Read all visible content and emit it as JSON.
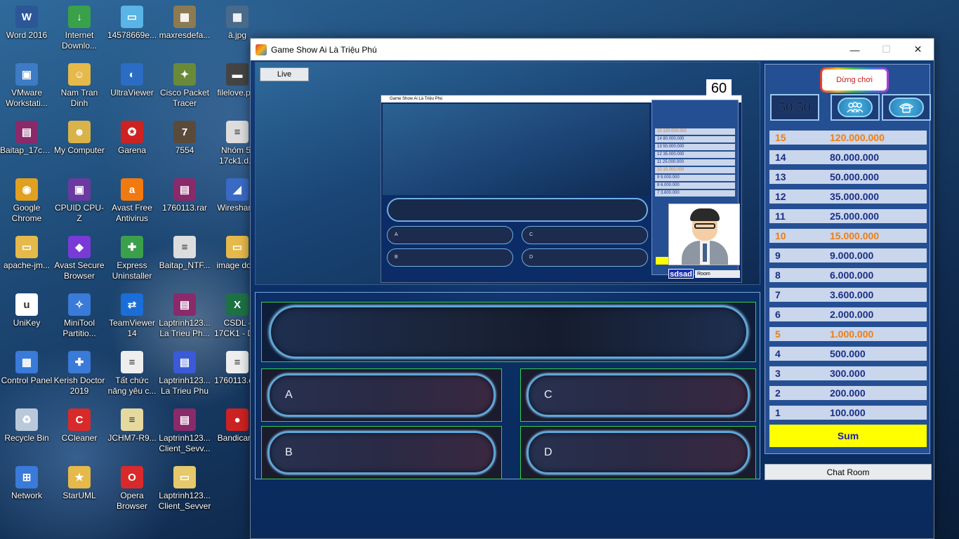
{
  "desktop": {
    "icons": [
      {
        "label": "Word 2016",
        "icon": "word-icon",
        "color": "#2b5797",
        "glyph": "W"
      },
      {
        "label": "Internet Downlo...",
        "icon": "idm-icon",
        "color": "#3aa04a",
        "glyph": "↓"
      },
      {
        "label": "14578669e...",
        "icon": "image-icon",
        "color": "#5ab4e6",
        "glyph": "▭"
      },
      {
        "label": "maxresdefa...",
        "icon": "image-icon",
        "color": "#8c7a52",
        "glyph": "▦"
      },
      {
        "label": "â.jpg",
        "icon": "image-icon",
        "color": "#4a6a8a",
        "glyph": "▦"
      },
      {
        "label": "VMware Workstati...",
        "icon": "vmware-icon",
        "color": "#3d7bc4",
        "glyph": "▣"
      },
      {
        "label": "Nam Tran Dinh",
        "icon": "user-folder-icon",
        "color": "#e5b94a",
        "glyph": "☺"
      },
      {
        "label": "UltraViewer",
        "icon": "ultraviewer-icon",
        "color": "#2b6cc4",
        "glyph": "◐"
      },
      {
        "label": "Cisco Packet Tracer",
        "icon": "cisco-icon",
        "color": "#6a8a3a",
        "glyph": "✦"
      },
      {
        "label": "filelove.p...",
        "icon": "file-icon",
        "color": "#444",
        "glyph": "▬"
      },
      {
        "label": "Baitap_17ck...",
        "icon": "winrar-icon",
        "color": "#8a2a6a",
        "glyph": "▤"
      },
      {
        "label": "My Computer",
        "icon": "computer-icon",
        "color": "#d9b34a",
        "glyph": "☻"
      },
      {
        "label": "Garena",
        "icon": "garena-icon",
        "color": "#c22",
        "glyph": "✪"
      },
      {
        "label": "7554",
        "icon": "game-icon",
        "color": "#5a4a3a",
        "glyph": "7"
      },
      {
        "label": "Nhóm 5-17ck1.d...",
        "icon": "document-icon",
        "color": "#ddd",
        "glyph": "≡"
      },
      {
        "label": "Google Chrome",
        "icon": "chrome-icon",
        "color": "#e0a020",
        "glyph": "◉"
      },
      {
        "label": "CPUID CPU-Z",
        "icon": "cpuz-icon",
        "color": "#6a3aa0",
        "glyph": "▣"
      },
      {
        "label": "Avast Free Antivirus",
        "icon": "avast-icon",
        "color": "#f07a10",
        "glyph": "a"
      },
      {
        "label": "1760113.rar",
        "icon": "winrar-icon",
        "color": "#8a2a6a",
        "glyph": "▤"
      },
      {
        "label": "Wireshar...",
        "icon": "wireshark-icon",
        "color": "#3a6ac4",
        "glyph": "◢"
      },
      {
        "label": "apache-jm...",
        "icon": "folder-icon",
        "color": "#e5b94a",
        "glyph": "▭"
      },
      {
        "label": "Avast Secure Browser",
        "icon": "avast-browser-icon",
        "color": "#7a3ad8",
        "glyph": "◆"
      },
      {
        "label": "Express Uninstaller",
        "icon": "uninstaller-icon",
        "color": "#3aa04a",
        "glyph": "✚"
      },
      {
        "label": "Baitap_NTF...",
        "icon": "document-icon",
        "color": "#ddd",
        "glyph": "≡"
      },
      {
        "label": "image do...",
        "icon": "folder-icon",
        "color": "#e5b94a",
        "glyph": "▭"
      },
      {
        "label": "UniKey",
        "icon": "unikey-icon",
        "color": "#ffffff",
        "glyph": "u"
      },
      {
        "label": "MiniTool Partitio...",
        "icon": "minitool-icon",
        "color": "#3a7ad8",
        "glyph": "✧"
      },
      {
        "label": "TeamViewer 14",
        "icon": "teamviewer-icon",
        "color": "#1a6ed8",
        "glyph": "⇄"
      },
      {
        "label": "Laptrinh123... La Trieu Ph...",
        "icon": "winrar-icon",
        "color": "#8a2a6a",
        "glyph": "▤"
      },
      {
        "label": "CSDL - 17CK1 - D...",
        "icon": "excel-icon",
        "color": "#1e7145",
        "glyph": "X"
      },
      {
        "label": "Control Panel",
        "icon": "control-panel-icon",
        "color": "#3a7ad8",
        "glyph": "▦"
      },
      {
        "label": "Kerish Doctor 2019",
        "icon": "kerish-icon",
        "color": "#3a7ad8",
        "glyph": "✚"
      },
      {
        "label": "Tất chức năng yêu c...",
        "icon": "document-icon",
        "color": "#eee",
        "glyph": "≡"
      },
      {
        "label": "Laptrinh123... La Trieu Phu",
        "icon": "winrar-icon",
        "color": "#3a5ad8",
        "glyph": "▤"
      },
      {
        "label": "1760113.d...",
        "icon": "document-icon",
        "color": "#eee",
        "glyph": "≡"
      },
      {
        "label": "Recycle Bin",
        "icon": "recycle-bin-icon",
        "color": "#b9c9d9",
        "glyph": "♻"
      },
      {
        "label": "CCleaner",
        "icon": "ccleaner-icon",
        "color": "#d82a2a",
        "glyph": "C"
      },
      {
        "label": "JCHM7-R9...",
        "icon": "document-icon",
        "color": "#e5d9a0",
        "glyph": "≡"
      },
      {
        "label": "Laptrinh123... Client_Sevv...",
        "icon": "winrar-icon",
        "color": "#8a2a6a",
        "glyph": "▤"
      },
      {
        "label": "Bandicar...",
        "icon": "bandicam-icon",
        "color": "#c22",
        "glyph": "●"
      },
      {
        "label": "Network",
        "icon": "network-icon",
        "color": "#3a7ad8",
        "glyph": "⊞"
      },
      {
        "label": "StarUML",
        "icon": "staruml-icon",
        "color": "#e5b94a",
        "glyph": "★"
      },
      {
        "label": "Opera Browser",
        "icon": "opera-icon",
        "color": "#d82a2a",
        "glyph": "O"
      },
      {
        "label": "Laptrinh123... Client_Sevver",
        "icon": "folder-icon",
        "color": "#e5c96a",
        "glyph": "▭"
      }
    ]
  },
  "window": {
    "title": "Game Show Ai Là Triệu Phú",
    "minimize": "—",
    "maximize": "☐",
    "close": "✕"
  },
  "preview": {
    "live_label": "Live",
    "timer": "60",
    "player_name": "sdsad",
    "room_label": "Room",
    "mini_title": "Game Show Ai Là Triệu Phú",
    "mini_live": "Live",
    "mini_timer": "60",
    "mini_answers": [
      "A",
      "B",
      "C",
      "D"
    ],
    "mini_prizes": [
      {
        "level": "15",
        "amount": "120.000.000",
        "milestone": true
      },
      {
        "level": "14",
        "amount": "80.000.000",
        "milestone": false
      },
      {
        "level": "13",
        "amount": "50.000.000",
        "milestone": false
      },
      {
        "level": "12",
        "amount": "35.000.000",
        "milestone": false
      },
      {
        "level": "11",
        "amount": "25.000.000",
        "milestone": false
      },
      {
        "level": "10",
        "amount": "15.000.000",
        "milestone": true
      },
      {
        "level": "9",
        "amount": "9.000.000",
        "milestone": false
      },
      {
        "level": "8",
        "amount": "6.000.000",
        "milestone": false
      },
      {
        "level": "7",
        "amount": "3.600.000",
        "milestone": false
      }
    ]
  },
  "question": {
    "text": "",
    "answers": [
      {
        "letter": "A",
        "text": ""
      },
      {
        "letter": "B",
        "text": ""
      },
      {
        "letter": "C",
        "text": ""
      },
      {
        "letter": "D",
        "text": ""
      }
    ]
  },
  "panel": {
    "quit_label": "Dừng chơi",
    "lifeline_5050": "50/50",
    "lifeline_audience_icon": "audience-icon",
    "lifeline_phone_icon": "phone-icon",
    "prizes": [
      {
        "level": "15",
        "amount": "120.000.000",
        "milestone": true
      },
      {
        "level": "14",
        "amount": "80.000.000",
        "milestone": false
      },
      {
        "level": "13",
        "amount": "50.000.000",
        "milestone": false
      },
      {
        "level": "12",
        "amount": "35.000.000",
        "milestone": false
      },
      {
        "level": "11",
        "amount": "25.000.000",
        "milestone": false
      },
      {
        "level": "10",
        "amount": "15.000.000",
        "milestone": true
      },
      {
        "level": "9",
        "amount": "9.000.000",
        "milestone": false
      },
      {
        "level": "8",
        "amount": "6.000.000",
        "milestone": false
      },
      {
        "level": "7",
        "amount": "3.600.000",
        "milestone": false
      },
      {
        "level": "6",
        "amount": "2.000.000",
        "milestone": false
      },
      {
        "level": "5",
        "amount": "1.000.000",
        "milestone": true
      },
      {
        "level": "4",
        "amount": "500.000",
        "milestone": false
      },
      {
        "level": "3",
        "amount": "300.000",
        "milestone": false
      },
      {
        "level": "2",
        "amount": "200.000",
        "milestone": false
      },
      {
        "level": "1",
        "amount": "100.000",
        "milestone": false
      }
    ],
    "sum_label": "Sum",
    "chat_label": "Chat Room"
  },
  "colors": {
    "milestone": "#f07d10",
    "prize_text": "#1a2f86",
    "sum_bg": "#ffff00",
    "panel_bg": "#254f93"
  }
}
